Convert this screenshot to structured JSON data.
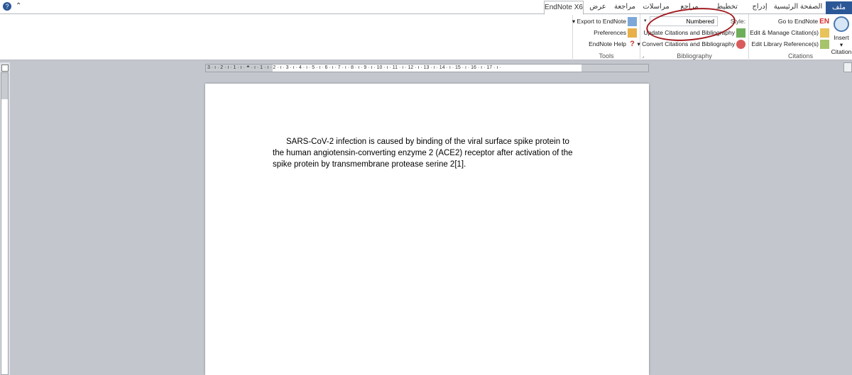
{
  "tabs": {
    "file": "ملف",
    "home": "الصفحة الرئيسية",
    "insert": "إدراج",
    "page_layout": "تخطيط الصفحة",
    "references": "مراجع",
    "mailings": "مراسلات",
    "review": "مراجعة",
    "view": "عرض",
    "endnote": "EndNote X6"
  },
  "ribbon": {
    "citations": {
      "label": "Citations",
      "insert": "Insert",
      "insert2": "Citation",
      "go_to": "Go to EndNote",
      "edit_manage": "Edit & Manage Citation(s)",
      "edit_library": "Edit Library Reference(s)"
    },
    "bibliography": {
      "label": "Bibliography",
      "style_label": "Style:",
      "style_value": "Numbered",
      "update": "Update Citations and Bibliography",
      "convert": "Convert Citations and Bibliography"
    },
    "tools": {
      "label": "Tools",
      "export": "Export to EndNote",
      "preferences": "Preferences",
      "help": "EndNote Help"
    }
  },
  "ruler": "3 · ı · 2 · ı · 1 · ı · 🞁 · ı · 1 · ı · 2 · ı · 3 · ı · 4 · ı · 5 · ı · 6 · ı · 7 · ı · 8 · ı · 9 · ı · 10 · ı · 11 · ı · 12 · ı · 13 · ı · 14 · ı · 15 · ı · 16 · ı · 17 · ı ·",
  "document": {
    "line1": "SARS-CoV-2 infection is caused by binding of the viral surface spike protein to",
    "line2": "the human angiotensin-converting enzyme 2 (ACE2) receptor after activation of the",
    "line3": "spike protein by transmembrane protease serine 2[1]."
  }
}
